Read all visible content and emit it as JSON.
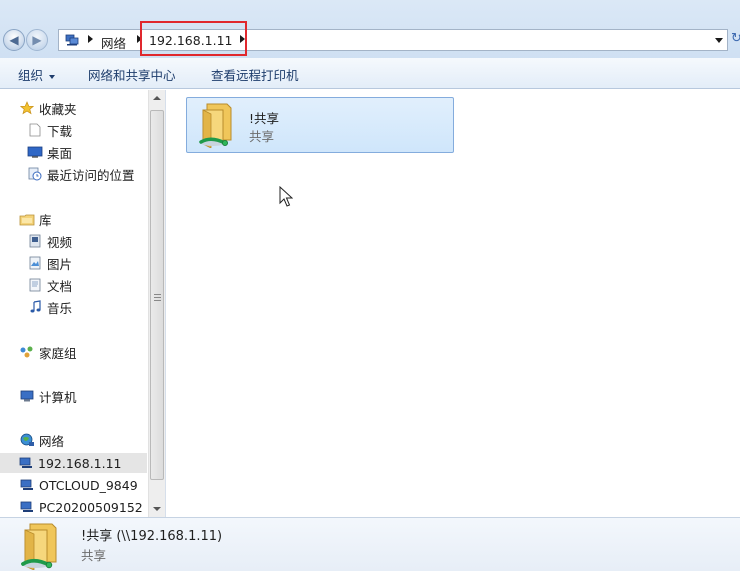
{
  "address_bar": {
    "breadcrumbs": [
      "网络",
      "192.168.1.11"
    ],
    "highlight_color": "#e0282e"
  },
  "command_bar": {
    "organize": "组织",
    "network_center": "网络和共享中心",
    "view_printers": "查看远程打印机"
  },
  "nav_pane": {
    "favorites": {
      "label": "收藏夹",
      "icon": "star-icon"
    },
    "downloads": {
      "label": "下载",
      "icon": "download-folder-icon"
    },
    "desktop": {
      "label": "桌面",
      "icon": "desktop-icon"
    },
    "recent": {
      "label": "最近访问的位置",
      "icon": "recent-places-icon"
    },
    "libraries": {
      "label": "库",
      "icon": "library-icon"
    },
    "videos": {
      "label": "视频",
      "icon": "video-library-icon"
    },
    "pictures": {
      "label": "图片",
      "icon": "picture-library-icon"
    },
    "documents": {
      "label": "文档",
      "icon": "document-library-icon"
    },
    "music": {
      "label": "音乐",
      "icon": "music-library-icon"
    },
    "homegroup": {
      "label": "家庭组",
      "icon": "homegroup-icon"
    },
    "computer": {
      "label": "计算机",
      "icon": "computer-icon"
    },
    "network": {
      "label": "网络",
      "icon": "network-icon"
    },
    "hosts": [
      {
        "label": "192.168.1.11",
        "selected": true
      },
      {
        "label": "OTCLOUD_9849"
      },
      {
        "label": "PC20200509152"
      }
    ]
  },
  "content": {
    "items": [
      {
        "name": "!共享",
        "type": "共享",
        "icon": "shared-folder-icon"
      }
    ]
  },
  "details_pane": {
    "title": "!共享 (\\\\192.168.1.11)",
    "type": "共享"
  }
}
